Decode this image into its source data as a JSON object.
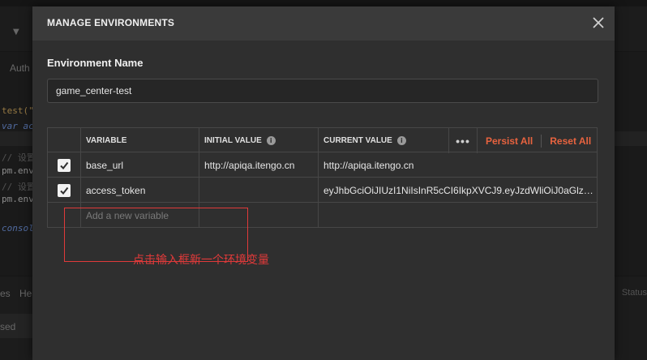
{
  "background": {
    "tab_auth": "Auth",
    "code_lines": [
      {
        "text": "test(\"",
        "cls": "c-yellow"
      },
      {
        "text": "var ac",
        "cls": "c-blue"
      },
      {
        "text": "// 设置",
        "cls": "c-grey"
      },
      {
        "text": "pm.env",
        "cls": "c-plain"
      },
      {
        "text": "// 设置",
        "cls": "c-grey"
      },
      {
        "text": "pm.env",
        "cls": "c-plain"
      },
      {
        "text": "consol",
        "cls": "c-blue"
      }
    ],
    "bottom_tab_es": "es",
    "bottom_tab_he": "He",
    "status_label": "Status",
    "sed_label": "sed"
  },
  "modal": {
    "title": "MANAGE ENVIRONMENTS",
    "env_name_label": "Environment Name",
    "env_name_value": "game_center-test",
    "table": {
      "headers": {
        "variable": "VARIABLE",
        "initial_value": "INITIAL VALUE",
        "current_value": "CURRENT VALUE"
      },
      "persist_all": "Persist All",
      "reset_all": "Reset All",
      "rows": [
        {
          "checked": true,
          "variable": "base_url",
          "initial": "http://apiqa.itengo.cn",
          "current": "http://apiqa.itengo.cn"
        },
        {
          "checked": true,
          "variable": "access_token",
          "initial": "",
          "current": "eyJhbGciOiJIUzI1NiIsInR5cCI6IkpXVCJ9.eyJzdWliOiJ0aGlzIGl..."
        }
      ],
      "add_placeholder": "Add a new variable"
    }
  },
  "annotation": {
    "text": "点击输入框新一个环境变量",
    "color": "#e03a3a"
  },
  "colors": {
    "accent": "#e8633f"
  }
}
